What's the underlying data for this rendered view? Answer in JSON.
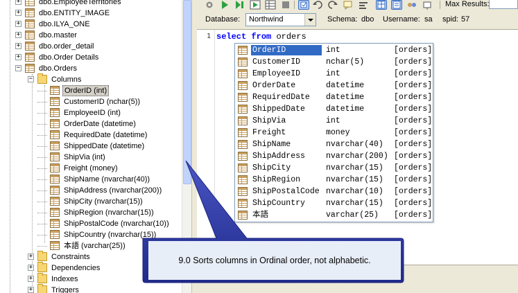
{
  "tree": {
    "items": [
      {
        "label": "dbo.EmployeeTerritories",
        "type": "table",
        "expander": "+"
      },
      {
        "label": "dbo.ENTITY_IMAGE",
        "type": "table",
        "expander": "+"
      },
      {
        "label": "dbo.ILYA_ONE",
        "type": "table",
        "expander": "+"
      },
      {
        "label": "dbo.master",
        "type": "table",
        "expander": "+"
      },
      {
        "label": "dbo.order_detail",
        "type": "table",
        "expander": "+"
      },
      {
        "label": "dbo.Order Details",
        "type": "table",
        "expander": "+"
      },
      {
        "label": "dbo.Orders",
        "type": "table",
        "expander": "−"
      },
      {
        "label": "Columns",
        "type": "folder",
        "expander": "−"
      },
      {
        "label": "OrderID (int)",
        "type": "column",
        "selected": true
      },
      {
        "label": "CustomerID (nchar(5))",
        "type": "column"
      },
      {
        "label": "EmployeeID (int)",
        "type": "column"
      },
      {
        "label": "OrderDate (datetime)",
        "type": "column"
      },
      {
        "label": "RequiredDate (datetime)",
        "type": "column"
      },
      {
        "label": "ShippedDate (datetime)",
        "type": "column"
      },
      {
        "label": "ShipVia (int)",
        "type": "column"
      },
      {
        "label": "Freight (money)",
        "type": "column"
      },
      {
        "label": "ShipName (nvarchar(40))",
        "type": "column"
      },
      {
        "label": "ShipAddress (nvarchar(200))",
        "type": "column"
      },
      {
        "label": "ShipCity (nvarchar(15))",
        "type": "column"
      },
      {
        "label": "ShipRegion (nvarchar(15))",
        "type": "column"
      },
      {
        "label": "ShipPostalCode (nvarchar(10))",
        "type": "column"
      },
      {
        "label": "ShipCountry (nvarchar(15))",
        "type": "column"
      },
      {
        "label": "本語 (varchar(25))",
        "type": "column"
      },
      {
        "label": "Constraints",
        "type": "folder",
        "expander": "+"
      },
      {
        "label": "Dependencies",
        "type": "folder",
        "expander": "+"
      },
      {
        "label": "Indexes",
        "type": "folder",
        "expander": "+"
      },
      {
        "label": "Triggers",
        "type": "folder",
        "expander": "+"
      }
    ]
  },
  "toolbar": {
    "max_results_label": "Max Results:",
    "max_results_value": ""
  },
  "infobar": {
    "database_label": "Database:",
    "database_value": "Northwind",
    "schema_label": "Schema:",
    "schema_value": "dbo",
    "username_label": "Username:",
    "username_value": "sa",
    "spid_label": "spid:",
    "spid_value": "57"
  },
  "editor": {
    "line_number": "1",
    "keyword_select": "select",
    "keyword_from": "from",
    "table_name": "orders"
  },
  "completion": {
    "items": [
      {
        "name": "OrderID",
        "type": "int",
        "scope": "[orders]",
        "selected": true
      },
      {
        "name": "CustomerID",
        "type": "nchar(5)",
        "scope": "[orders]"
      },
      {
        "name": "EmployeeID",
        "type": "int",
        "scope": "[orders]"
      },
      {
        "name": "OrderDate",
        "type": "datetime",
        "scope": "[orders]"
      },
      {
        "name": "RequiredDate",
        "type": "datetime",
        "scope": "[orders]"
      },
      {
        "name": "ShippedDate",
        "type": "datetime",
        "scope": "[orders]"
      },
      {
        "name": "ShipVia",
        "type": "int",
        "scope": "[orders]"
      },
      {
        "name": "Freight",
        "type": "money",
        "scope": "[orders]"
      },
      {
        "name": "ShipName",
        "type": "nvarchar(40)",
        "scope": "[orders]"
      },
      {
        "name": "ShipAddress",
        "type": "nvarchar(200)",
        "scope": "[orders]"
      },
      {
        "name": "ShipCity",
        "type": "nvarchar(15)",
        "scope": "[orders]"
      },
      {
        "name": "ShipRegion",
        "type": "nvarchar(15)",
        "scope": "[orders]"
      },
      {
        "name": "ShipPostalCode",
        "type": "nvarchar(10)",
        "scope": "[orders]"
      },
      {
        "name": "ShipCountry",
        "type": "nvarchar(15)",
        "scope": "[orders]"
      },
      {
        "name": "本語",
        "type": "varchar(25)",
        "scope": "[orders]"
      }
    ]
  },
  "callout": {
    "text": "9.0 Sorts columns in Ordinal order, not alphabetic.",
    "fill_color": "#2e3aa8",
    "highlight_color": "#e8eef8"
  },
  "colors": {
    "keyword": "#0000ff",
    "selection": "#316ac5",
    "chrome": "#ece9d8"
  }
}
